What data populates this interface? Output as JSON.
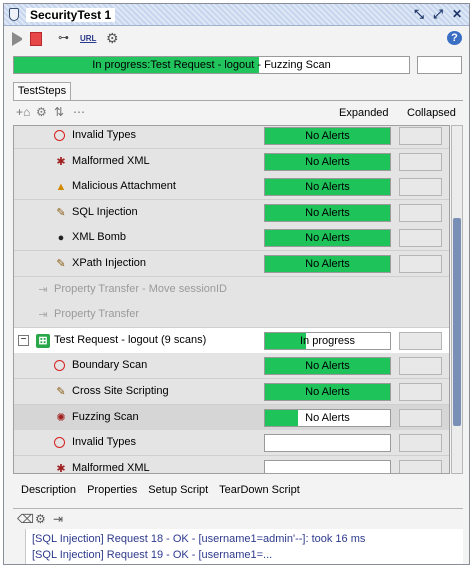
{
  "window": {
    "title": "SecurityTest 1"
  },
  "toolbar": {
    "url_label": "URL"
  },
  "progress": {
    "status_text": "In progress:Test Request - logout",
    "scan_text": " - Fuzzing Scan",
    "fraction": 0.62
  },
  "tabs": {
    "teststeps": "TestSteps"
  },
  "columns": {
    "expanded": "Expanded",
    "collapsed": "Collapsed"
  },
  "rows": [
    {
      "label": "Invalid Types",
      "status": "No Alerts",
      "fill": 1.0,
      "icon": "ban-icon"
    },
    {
      "label": "Malformed XML",
      "status": "No Alerts",
      "fill": 1.0,
      "icon": "malformed-xml-icon"
    },
    {
      "label": "Malicious Attachment",
      "status": "No Alerts",
      "fill": 1.0,
      "icon": "warning-icon"
    },
    {
      "label": "SQL Injection",
      "status": "No Alerts",
      "fill": 1.0,
      "icon": "sql-injection-icon"
    },
    {
      "label": "XML Bomb",
      "status": "No Alerts",
      "fill": 1.0,
      "icon": "bomb-icon"
    },
    {
      "label": "XPath Injection",
      "status": "No Alerts",
      "fill": 1.0,
      "icon": "xpath-injection-icon"
    },
    {
      "label": "Property Transfer - Move sessionID",
      "icon": "property-transfer-icon"
    },
    {
      "label": "Property Transfer",
      "icon": "property-transfer-icon"
    },
    {
      "label": "Test Request - logout (9 scans)",
      "status": "In progress",
      "fill": 0.33,
      "icon": "test-request-icon",
      "expander": "−"
    },
    {
      "label": "Boundary Scan",
      "status": "No Alerts",
      "fill": 1.0,
      "icon": "boundary-scan-icon"
    },
    {
      "label": "Cross Site Scripting",
      "status": "No Alerts",
      "fill": 1.0,
      "icon": "xss-icon"
    },
    {
      "label": "Fuzzing Scan",
      "status": "No Alerts",
      "fill": 0.26,
      "icon": "fuzzing-icon"
    },
    {
      "label": "Invalid Types",
      "status": "",
      "fill": 0.0,
      "icon": "ban-icon"
    },
    {
      "label": "Malformed XML",
      "icon": "malformed-xml-icon"
    }
  ],
  "bottom_tabs": [
    "Description",
    "Properties",
    "Setup Script",
    "TearDown Script"
  ],
  "log": [
    "[SQL Injection] Request 18 - OK - [username1=admin'--]: took 16 ms",
    "[SQL Injection] Request 19 - OK - [username1=..."
  ],
  "colors": {
    "accent_green": "#22c45e",
    "title_blue": "#c7d6ee",
    "log_text": "#2d3a8c"
  }
}
